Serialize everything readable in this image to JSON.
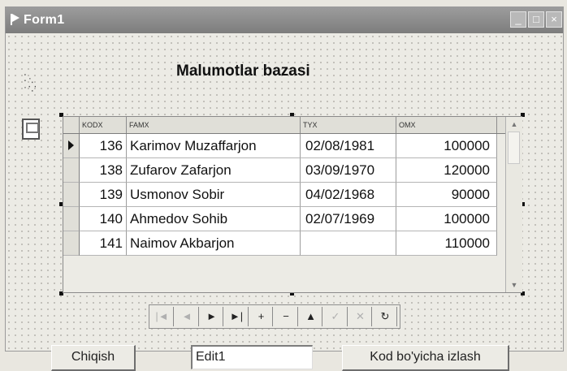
{
  "window": {
    "title": "Form1",
    "minimize_label": "_",
    "maximize_label": "□",
    "close_label": "×"
  },
  "heading": "Malumotlar bazasi",
  "grid": {
    "columns": [
      "KODX",
      "FAMX",
      "TYX",
      "OMX"
    ],
    "rows": [
      {
        "kod": "136",
        "fam": "Karimov Muzaffarjon",
        "tug": "02/08/1981",
        "oy": "100000"
      },
      {
        "kod": "138",
        "fam": "Zufarov Zafarjon",
        "tug": "03/09/1970",
        "oy": "120000"
      },
      {
        "kod": "139",
        "fam": "Usmonov Sobir",
        "tug": "04/02/1968",
        "oy": "90000"
      },
      {
        "kod": "140",
        "fam": "Ahmedov Sohib",
        "tug": "02/07/1969",
        "oy": "100000"
      },
      {
        "kod": "141",
        "fam": "Naimov Akbarjon",
        "tug": "",
        "oy": "110000"
      }
    ]
  },
  "navigator": {
    "buttons": [
      {
        "name": "first",
        "glyph": "|◄",
        "enabled": false
      },
      {
        "name": "prior",
        "glyph": "◄",
        "enabled": false
      },
      {
        "name": "next",
        "glyph": "►",
        "enabled": true
      },
      {
        "name": "last",
        "glyph": "►|",
        "enabled": true
      },
      {
        "name": "insert",
        "glyph": "+",
        "enabled": true
      },
      {
        "name": "delete",
        "glyph": "−",
        "enabled": true
      },
      {
        "name": "edit",
        "glyph": "▲",
        "enabled": true
      },
      {
        "name": "post",
        "glyph": "✓",
        "enabled": false
      },
      {
        "name": "cancel",
        "glyph": "✕",
        "enabled": false
      },
      {
        "name": "refresh",
        "glyph": "↻",
        "enabled": true
      }
    ]
  },
  "buttons": {
    "exit": "Chiqish",
    "search": "Kod bo'yicha izlash"
  },
  "edit": {
    "value": "Edit1"
  }
}
